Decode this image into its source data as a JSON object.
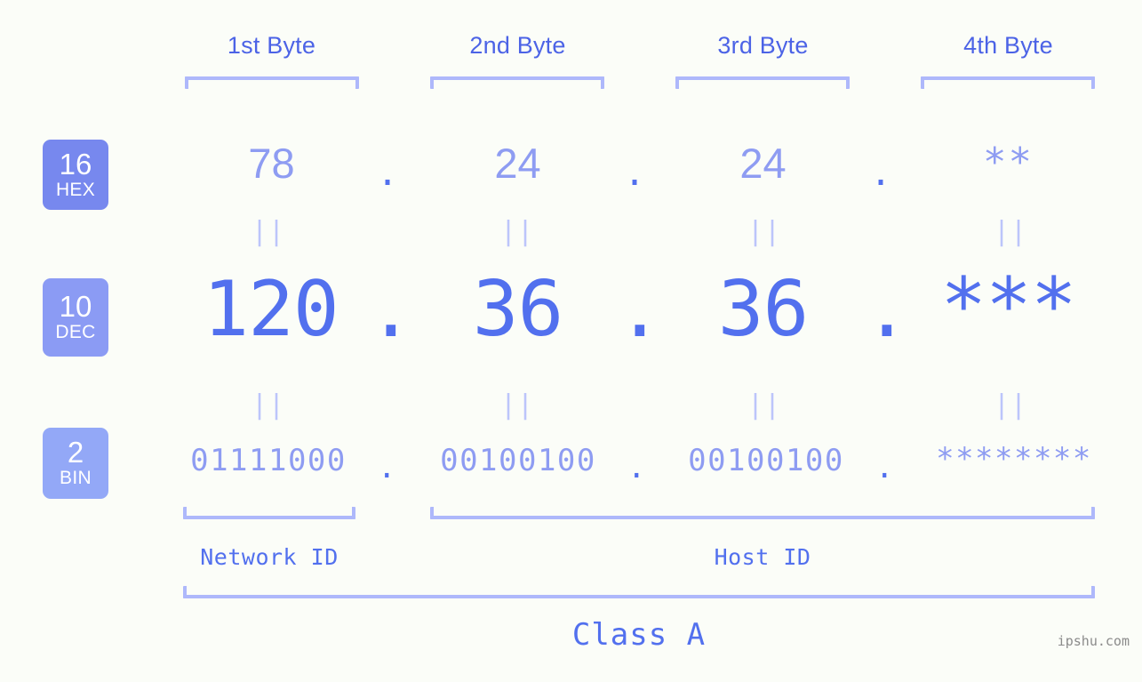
{
  "page": {
    "background_color": "#fbfdf8",
    "accent_color": "#5270ee",
    "accent_light_color": "#8e9cf2",
    "bracket_color": "#aeb8fb",
    "watermark": "ipshu.com"
  },
  "byte_headers": [
    {
      "label": "1st Byte"
    },
    {
      "label": "2nd Byte"
    },
    {
      "label": "3rd Byte"
    },
    {
      "label": "4th Byte"
    }
  ],
  "radix_badges": [
    {
      "number": "16",
      "name": "HEX",
      "color": "#7788ee"
    },
    {
      "number": "10",
      "name": "DEC",
      "color": "#8b9bf4"
    },
    {
      "number": "2",
      "name": "BIN",
      "color": "#93a8f7"
    }
  ],
  "rows": {
    "hex": {
      "radix": "16",
      "radix_name": "HEX",
      "values": [
        "78",
        "24",
        "24",
        "**"
      ],
      "separator": "."
    },
    "dec": {
      "radix": "10",
      "radix_name": "DEC",
      "values": [
        "120",
        "36",
        "36",
        "***"
      ],
      "separator": "."
    },
    "bin": {
      "radix": "2",
      "radix_name": "BIN",
      "values": [
        "01111000",
        "00100100",
        "00100100",
        "********"
      ],
      "separator": "."
    }
  },
  "equality_marks": {
    "symbol": "||",
    "hex_to_dec_count": 4,
    "dec_to_bin_count": 4
  },
  "sections": [
    {
      "label": "Network ID"
    },
    {
      "label": "Host ID"
    }
  ],
  "class": {
    "label": "Class A"
  }
}
